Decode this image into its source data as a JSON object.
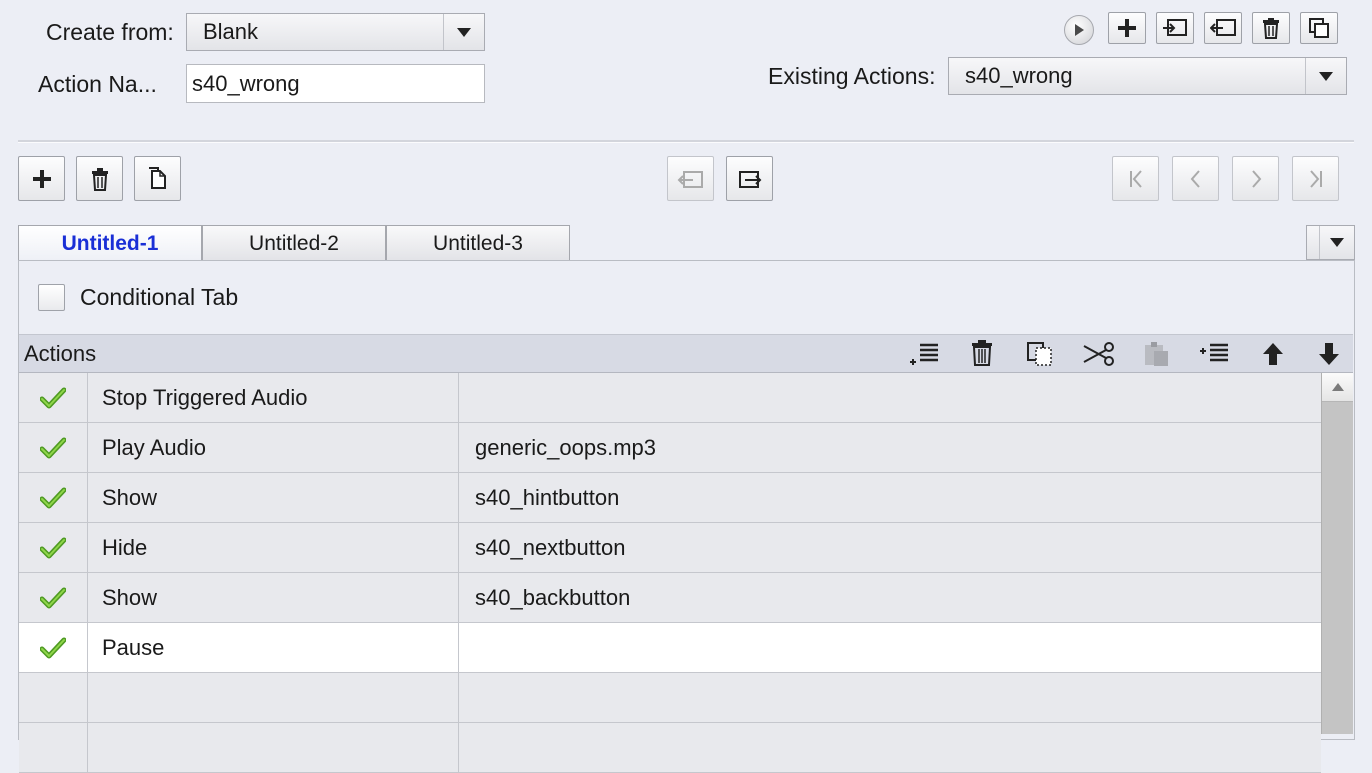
{
  "header": {
    "create_from_label": "Create from:",
    "create_from_value": "Blank",
    "action_name_label": "Action Na...",
    "action_name_value": "s40_wrong",
    "existing_actions_label": "Existing Actions:",
    "existing_actions_value": "s40_wrong"
  },
  "tabs": [
    {
      "label": "Untitled-1",
      "active": true
    },
    {
      "label": "Untitled-2",
      "active": false
    },
    {
      "label": "Untitled-3",
      "active": false
    }
  ],
  "conditional": {
    "label": "Conditional Tab",
    "checked": false
  },
  "actions_header": {
    "title": "Actions"
  },
  "rows": [
    {
      "action": "Stop Triggered Audio",
      "target": "",
      "enabled": true
    },
    {
      "action": "Play Audio",
      "target": "generic_oops.mp3",
      "enabled": true
    },
    {
      "action": "Show",
      "target": "s40_hintbutton",
      "enabled": true
    },
    {
      "action": "Hide",
      "target": "s40_nextbutton",
      "enabled": true
    },
    {
      "action": "Show",
      "target": "s40_backbutton",
      "enabled": true
    },
    {
      "action": "Pause",
      "target": "",
      "enabled": true,
      "selected": true
    },
    {
      "action": "",
      "target": ""
    },
    {
      "action": "",
      "target": ""
    }
  ],
  "colors": {
    "accent_tab": "#1a2fd6",
    "check": "#6cbb2e"
  }
}
